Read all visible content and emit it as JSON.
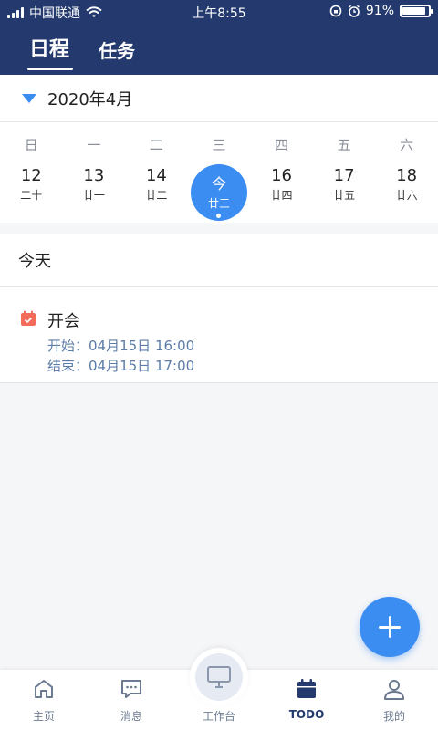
{
  "status_bar": {
    "carrier": "中国联通",
    "time": "上午8:55",
    "battery_percent": "91%",
    "battery_level": 0.91,
    "icons": [
      "signal-icon",
      "wifi-icon",
      "lock-rotation-icon",
      "alarm-icon",
      "battery-icon"
    ]
  },
  "top_tabs": [
    {
      "label": "日程",
      "active": true
    },
    {
      "label": "任务",
      "active": false
    }
  ],
  "month": {
    "label": "2020年4月"
  },
  "weekdays": [
    "日",
    "一",
    "二",
    "三",
    "四",
    "五",
    "六"
  ],
  "dates": [
    {
      "num": "12",
      "lunar": "二十"
    },
    {
      "num": "13",
      "lunar": "廿一"
    },
    {
      "num": "14",
      "lunar": "廿二"
    },
    {
      "num": "今",
      "lunar": "廿三",
      "today": true
    },
    {
      "num": "16",
      "lunar": "廿四"
    },
    {
      "num": "17",
      "lunar": "廿五"
    },
    {
      "num": "18",
      "lunar": "廿六"
    }
  ],
  "today_section": {
    "label": "今天"
  },
  "event": {
    "title": "开会",
    "start": "开始：04月15日 16:00",
    "end": "结束：04月15日 17:00"
  },
  "bottom_nav": [
    {
      "label": "主页",
      "icon": "home-icon"
    },
    {
      "label": "消息",
      "icon": "message-icon"
    },
    {
      "label": "工作台",
      "icon": "monitor-icon"
    },
    {
      "label": "TODO",
      "icon": "calendar-icon",
      "active": true
    },
    {
      "label": "我的",
      "icon": "user-icon"
    }
  ],
  "colors": {
    "header": "#243a6e",
    "accent": "#3b8df2",
    "event_icon": "#f26b5b"
  }
}
